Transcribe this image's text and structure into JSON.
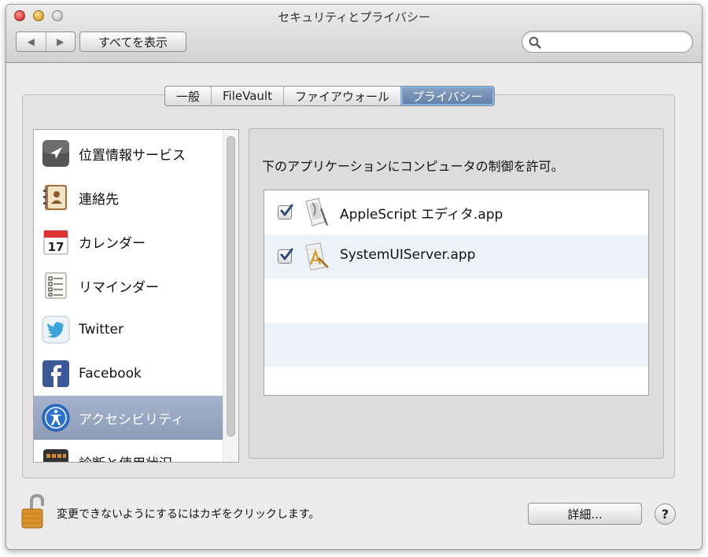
{
  "window": {
    "title": "セキュリティとプライバシー",
    "show_all_label": "すべてを表示",
    "back_glyph": "◀",
    "forward_glyph": "▶",
    "search_placeholder": ""
  },
  "tabs": [
    {
      "label": "一般",
      "active": false
    },
    {
      "label": "FileVault",
      "active": false
    },
    {
      "label": "ファイアウォール",
      "active": false
    },
    {
      "label": "プライバシー",
      "active": true
    }
  ],
  "sidebar": {
    "items": [
      {
        "label": "位置情報サービス",
        "icon": "location-arrow-icon",
        "selected": false
      },
      {
        "label": "連絡先",
        "icon": "contacts-book-icon",
        "selected": false
      },
      {
        "label": "カレンダー",
        "icon": "calendar-icon",
        "selected": false
      },
      {
        "label": "リマインダー",
        "icon": "reminders-list-icon",
        "selected": false
      },
      {
        "label": "Twitter",
        "icon": "twitter-bird-icon",
        "selected": false
      },
      {
        "label": "Facebook",
        "icon": "facebook-f-icon",
        "selected": false
      },
      {
        "label": "アクセシビリティ",
        "icon": "accessibility-person-icon",
        "selected": true
      },
      {
        "label": "診断と使用状況",
        "icon": "diagnostics-icon",
        "selected": false
      }
    ],
    "calendar_day": "17"
  },
  "main": {
    "prompt": "下のアプリケーションにコンピュータの制御を許可。",
    "apps": [
      {
        "name": "AppleScript エディタ.app",
        "checked": true,
        "icon": "applescript-editor-icon"
      },
      {
        "name": "SystemUIServer.app",
        "checked": true,
        "icon": "app-placeholder-icon"
      }
    ]
  },
  "footer": {
    "lock_text": "変更できないようにするにはカギをクリックします。",
    "details_label": "詳細...",
    "help_label": "?"
  },
  "colors": {
    "selection": "#8c9cb8",
    "active_tab": "#5f7da5",
    "checkbox_mark": "#2b4a7a"
  }
}
